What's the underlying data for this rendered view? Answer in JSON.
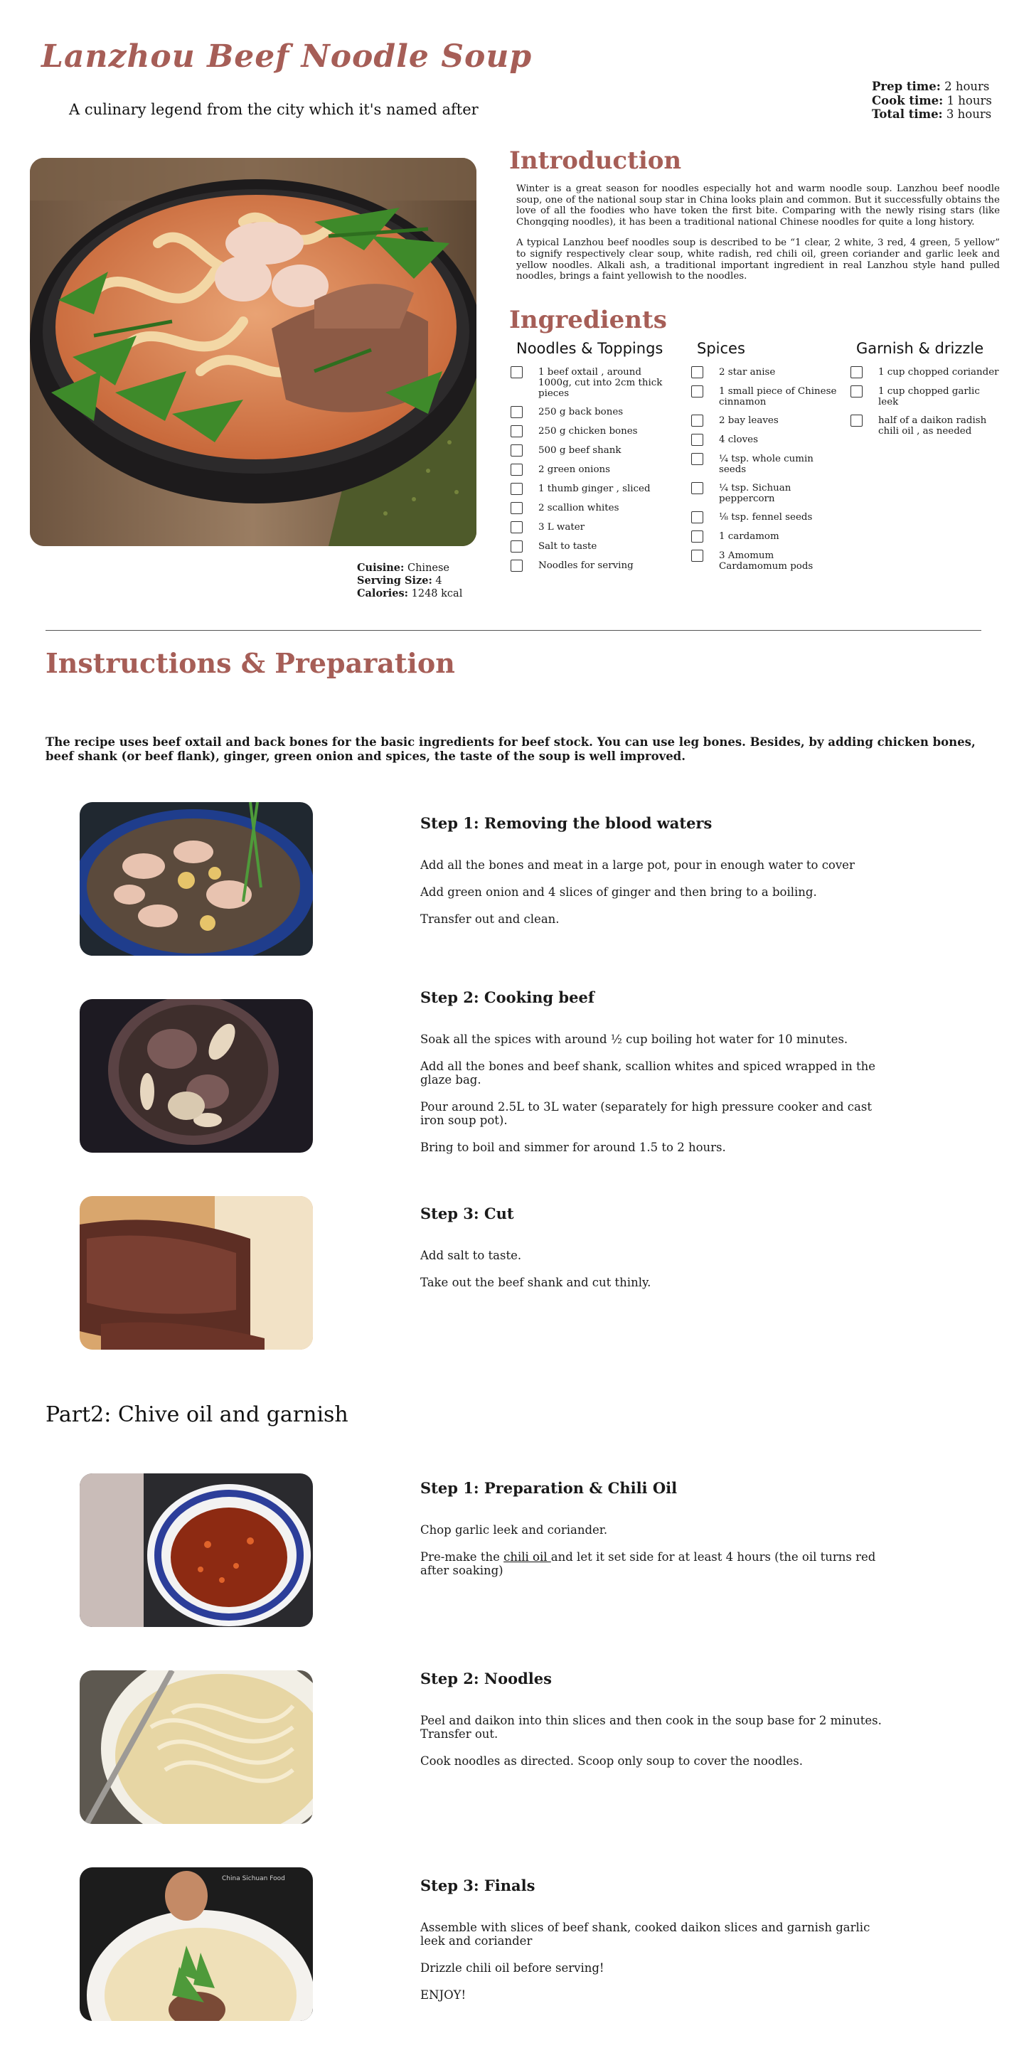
{
  "header": {
    "title": "Lanzhou Beef Noodle Soup",
    "subtitle": "A culinary legend from the city which it's named after",
    "prep_label": "Prep time:",
    "prep_value": "2 hours",
    "cook_label": "Cook time:",
    "cook_value": "1 hours",
    "total_label": "Total time:",
    "total_value": "3 hours"
  },
  "meta": {
    "cuisine_label": "Cuisine:",
    "cuisine_value": "Chinese",
    "serving_label": "Serving Size:",
    "serving_value": "4",
    "calories_label": "Calories:",
    "calories_value": "1248 kcal"
  },
  "intro": {
    "heading": "Introduction",
    "p1": "Winter is a great season for noodles especially hot and warm noodle soup. Lanzhou beef noodle soup, one of the national soup star in China looks plain and common. But it successfully obtains the love of all the foodies who have token the first bite. Comparing with the newly rising stars (like Chongqing noodles), it has been a traditional national Chinese noodles for quite a long history.",
    "p2": "A typical Lanzhou beef noodles soup is described to be “1 clear, 2 white, 3 red, 4 green, 5 yellow” to signify respectively clear soup, white radish, red chili oil, green coriander and garlic leek and yellow noodles. Alkali ash, a traditional important ingredient in real Lanzhou style hand pulled noodles, brings a faint yellowish to the noodles."
  },
  "ingredients": {
    "heading": "Ingredients",
    "col1": {
      "title": "Noodles & Toppings",
      "items": [
        "1 beef oxtail , around 1000g, cut into 2cm thick pieces",
        "250 g back bones",
        "250 g chicken bones",
        "500 g beef shank",
        "2 green onions",
        "1 thumb ginger , sliced",
        "2 scallion whites",
        "3 L water",
        "Salt to taste",
        "Noodles for serving"
      ]
    },
    "col2": {
      "title": "Spices",
      "items": [
        "2 star anise",
        "1 small piece of Chinese cinnamon",
        "2 bay leaves",
        "4 cloves",
        "¼ tsp. whole cumin seeds",
        "¼ tsp. Sichuan peppercorn",
        "⅛ tsp. fennel seeds",
        "1 cardamom",
        "3 Amomum Cardamomum pods"
      ]
    },
    "col3": {
      "title": "Garnish & drizzle",
      "items": [
        "1 cup chopped coriander",
        "1 cup chopped garlic leek",
        "half of a daikon radish chili oil , as needed"
      ]
    }
  },
  "instructions": {
    "heading": "Instructions & Preparation",
    "lead": "The recipe uses beef oxtail and back bones for the basic ingredients for beef stock. You can use leg bones. Besides, by adding chicken bones, beef shank (or beef flank), ginger, green onion and spices, the taste of the soup is well improved.",
    "part1": [
      {
        "title": "Step 1: Removing the blood waters",
        "lines": [
          "Add all the bones and meat in a large pot, pour in enough water to cover",
          "Add green onion and 4 slices of ginger and then bring to a boiling.",
          "Transfer out and clean."
        ]
      },
      {
        "title": "Step 2: Cooking beef",
        "lines": [
          "Soak all the spices with around ½ cup boiling hot water for 10 minutes.",
          "Add all the bones and beef shank, scallion whites and spiced wrapped in the glaze bag.",
          "Pour around 2.5L to 3L water (separately for high pressure cooker and cast iron soup pot).",
          "Bring to boil and simmer for around 1.5 to 2 hours."
        ]
      },
      {
        "title": "Step 3: Cut",
        "lines": [
          "Add salt to taste.",
          "Take out the beef shank and cut thinly."
        ]
      }
    ],
    "part2_heading": "Part2: Chive oil and garnish",
    "part2": [
      {
        "title": "Step 1: Preparation & Chili Oil",
        "line1": "Chop garlic leek and coriander.",
        "line2_pre": "Pre-make the ",
        "line2_link": "chili oil ",
        "line2_post": "and let it set side for at least 4 hours (the oil turns red after soaking)"
      },
      {
        "title": "Step 2: Noodles",
        "lines": [
          "Peel and daikon into thin slices and then cook in the soup base for 2 minutes. Transfer out.",
          "Cook noodles as directed. Scoop only soup to cover the noodles."
        ]
      },
      {
        "title": "Step 3: Finals",
        "lines": [
          "Assemble with slices of beef shank, cooked daikon slices and garnish garlic leek and coriander",
          "Drizzle chili oil before serving!",
          "ENJOY!"
        ]
      }
    ],
    "watermark": "China Sichuan Food"
  }
}
